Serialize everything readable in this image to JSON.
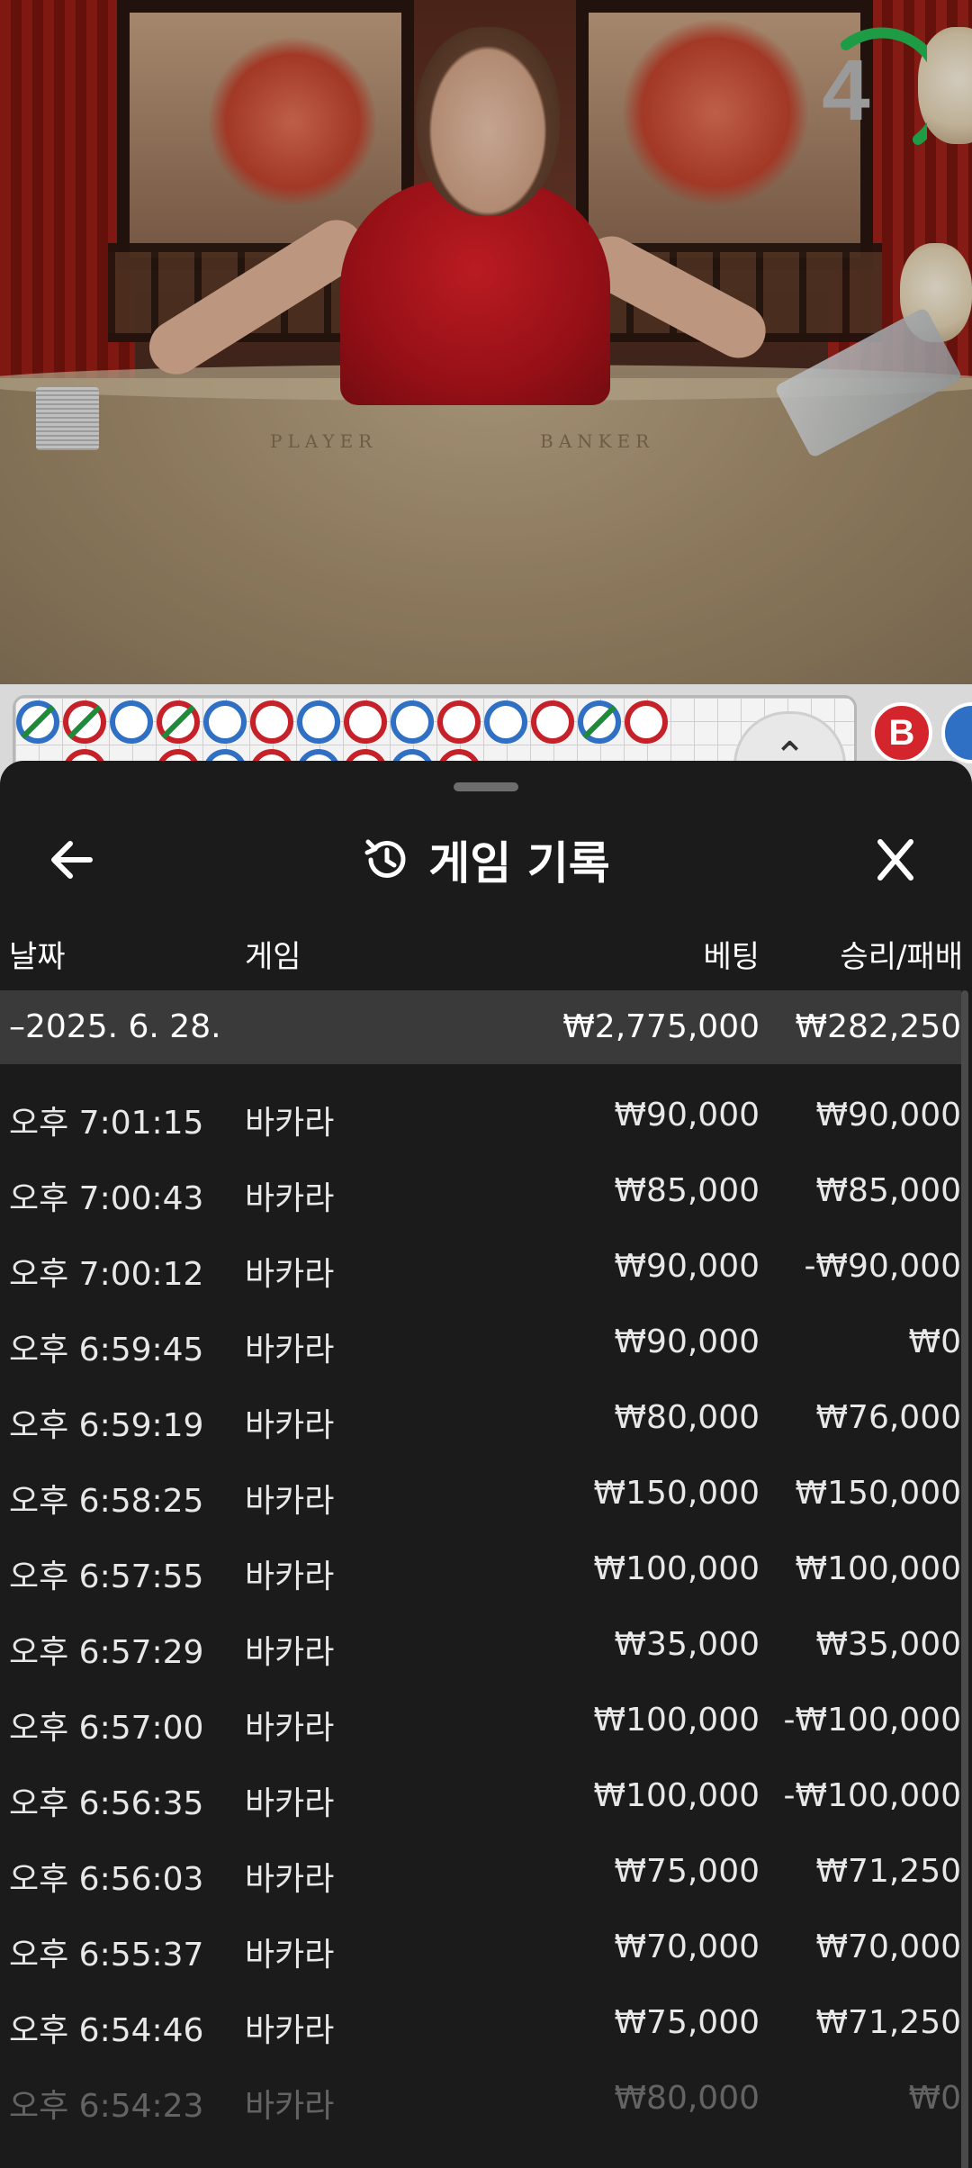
{
  "video": {
    "table_label_player": "PLAYER",
    "table_label_banker": "BANKER",
    "countdown": "4",
    "countdown_color": "#1e9c45"
  },
  "roadmap": {
    "top_row": [
      "P/",
      "B/",
      "P",
      "B/",
      "P",
      "B",
      "P",
      "B",
      "P",
      "B",
      "P",
      "B",
      "P/",
      "B"
    ],
    "banker_badge": "B",
    "colors": {
      "banker": "#c62128",
      "player": "#2f6fc4",
      "tie": "#1e8a3a"
    }
  },
  "sheet": {
    "title": "게임 기록",
    "columns": {
      "date": "날짜",
      "game": "게임",
      "bet": "베팅",
      "result": "승리/패배"
    },
    "summary": {
      "date": "–2025. 6. 28.",
      "bet": "₩2,775,000",
      "result": "₩282,250"
    },
    "rows": [
      {
        "time": "오후 7:01:15",
        "game": "바카라",
        "bet": "₩90,000",
        "result": "₩90,000"
      },
      {
        "time": "오후 7:00:43",
        "game": "바카라",
        "bet": "₩85,000",
        "result": "₩85,000"
      },
      {
        "time": "오후 7:00:12",
        "game": "바카라",
        "bet": "₩90,000",
        "result": "-₩90,000"
      },
      {
        "time": "오후 6:59:45",
        "game": "바카라",
        "bet": "₩90,000",
        "result": "₩0"
      },
      {
        "time": "오후 6:59:19",
        "game": "바카라",
        "bet": "₩80,000",
        "result": "₩76,000"
      },
      {
        "time": "오후 6:58:25",
        "game": "바카라",
        "bet": "₩150,000",
        "result": "₩150,000"
      },
      {
        "time": "오후 6:57:55",
        "game": "바카라",
        "bet": "₩100,000",
        "result": "₩100,000"
      },
      {
        "time": "오후 6:57:29",
        "game": "바카라",
        "bet": "₩35,000",
        "result": "₩35,000"
      },
      {
        "time": "오후 6:57:00",
        "game": "바카라",
        "bet": "₩100,000",
        "result": "-₩100,000"
      },
      {
        "time": "오후 6:56:35",
        "game": "바카라",
        "bet": "₩100,000",
        "result": "-₩100,000"
      },
      {
        "time": "오후 6:56:03",
        "game": "바카라",
        "bet": "₩75,000",
        "result": "₩71,250"
      },
      {
        "time": "오후 6:55:37",
        "game": "바카라",
        "bet": "₩70,000",
        "result": "₩70,000"
      },
      {
        "time": "오후 6:54:46",
        "game": "바카라",
        "bet": "₩75,000",
        "result": "₩71,250"
      },
      {
        "time": "오후 6:54:23",
        "game": "바카라",
        "bet": "₩80,000",
        "result": "₩0"
      }
    ]
  }
}
